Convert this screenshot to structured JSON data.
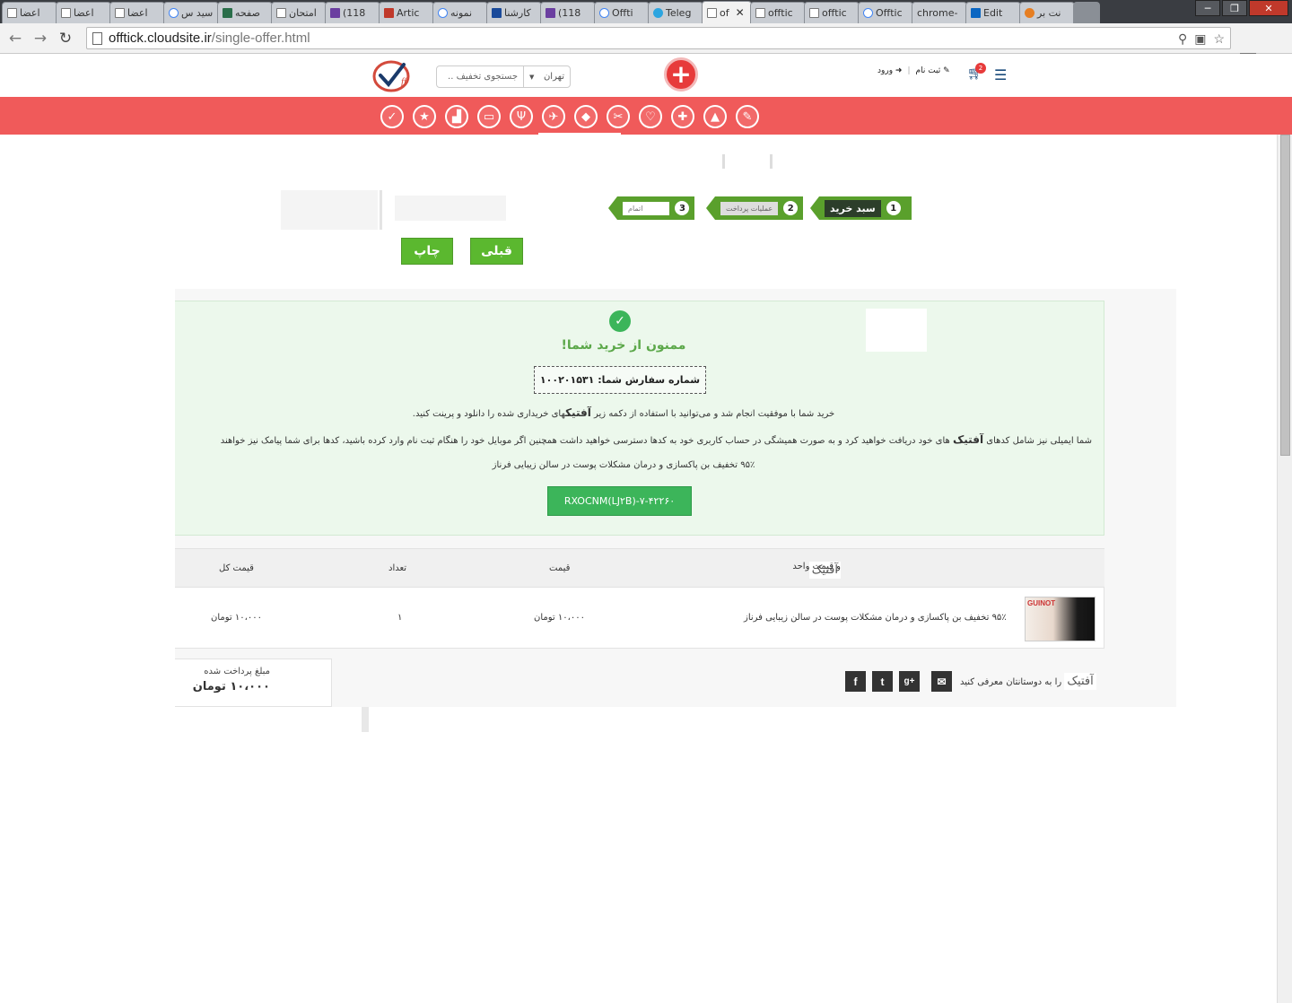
{
  "browser": {
    "tabs": [
      {
        "label": "اعضا",
        "icon": "page-icon"
      },
      {
        "label": "اعضا",
        "icon": "page-icon"
      },
      {
        "label": "اعضا",
        "icon": "page-icon"
      },
      {
        "label": "سید س",
        "icon": "google-icon"
      },
      {
        "label": "صفحه",
        "icon": "image-icon"
      },
      {
        "label": "امتحان",
        "icon": "page-icon"
      },
      {
        "label": "(118",
        "icon": "mail-icon"
      },
      {
        "label": "Artic",
        "icon": "stripes-icon"
      },
      {
        "label": "نمونه",
        "icon": "google-icon"
      },
      {
        "label": "کارشنا",
        "icon": "blue-icon"
      },
      {
        "label": "(118",
        "icon": "mail-icon"
      },
      {
        "label": "Offti",
        "icon": "offtick-icon"
      },
      {
        "label": "Teleg",
        "icon": "telegram-icon"
      },
      {
        "label": "of",
        "icon": "page-icon",
        "active": true
      },
      {
        "label": "offtic",
        "icon": "page-icon"
      },
      {
        "label": "offtic",
        "icon": "page-icon"
      },
      {
        "label": "Offtic",
        "icon": "offtick-icon"
      },
      {
        "label": "chrome-",
        "icon": "none"
      },
      {
        "label": "Edit",
        "icon": "linkedin-icon"
      },
      {
        "label": "نت بر",
        "icon": "red-icon"
      }
    ],
    "url_host": "offtick.cloudsite.ir",
    "url_path": "/single-offer.html"
  },
  "header": {
    "search_placeholder": "جستجوی تخفیف ..",
    "city": "تهران",
    "signup": "ثبت نام",
    "login": "ورود",
    "cart_count": "2"
  },
  "categories": [
    "tag-icon",
    "star-icon",
    "bag-icon",
    "car-icon",
    "food-icon",
    "plane-icon",
    "gift-icon",
    "salon-icon",
    "heart-icon",
    "medical-icon",
    "graduation-icon",
    "brush-icon"
  ],
  "steps": [
    {
      "num": "1",
      "label": "سبد خرید",
      "active": true
    },
    {
      "num": "2",
      "label": "عملیات پرداخت",
      "active": false
    },
    {
      "num": "3",
      "label": "اتمام",
      "active": false
    }
  ],
  "buttons": {
    "prev": "قبلی",
    "print": "چاپ"
  },
  "success": {
    "thanks": "ممنون از خرید شما!",
    "order_label": "شماره سفارش شما: ۱۰۰۲۰۱۵۳۱",
    "msg1_a": "خرید شما با موفقیت انجام شد و می‌توانید با استفاده از دکمه زیر ",
    "msg1_brand": "آفتیک",
    "msg1_b": "های خریداری شده را دانلود و پرینت کنید.",
    "msg2_a": "شما ایمیلی نیز شامل کدهای ",
    "msg2_brand": "آفتیک",
    "msg2_b": " های خود دریافت خواهید کرد و به صورت همیشگی در حساب کاربری خود به کدها دسترسی خواهید داشت همچنین اگر موبایل خود را هنگام ثبت نام وارد کرده باشید، کدها برای شما پیامک نیز خواهند",
    "offer_title": "۹۵٪ تخفیف بن پاکسازی و درمان مشکلات پوست در سالن زیبایی فرناز",
    "code": "RXOCNM(LJ۲B)-۷-۴۲۲۶۰"
  },
  "table": {
    "headers": {
      "item_brand": "آفتیک",
      "item": "و قیمت واحد",
      "price": "قیمت",
      "qty": "تعداد",
      "total": "قیمت کل"
    },
    "rows": [
      {
        "title": "۹۵٪ تخفیف بن پاکسازی و درمان مشکلات پوست در سالن زیبایی فرناز",
        "image_brand": "GUINOT",
        "price": "۱۰،۰۰۰ تومان",
        "qty": "۱",
        "total": "۱۰،۰۰۰ تومان"
      }
    ]
  },
  "paid": {
    "label": "مبلغ پرداخت شده",
    "amount": "۱۰،۰۰۰ تومان"
  },
  "share": {
    "brand": "آفتیک",
    "text": " را به دوستانتان معرفی کنید",
    "icons": [
      "facebook-icon",
      "twitter-icon",
      "google-plus-icon",
      "email-icon"
    ]
  }
}
